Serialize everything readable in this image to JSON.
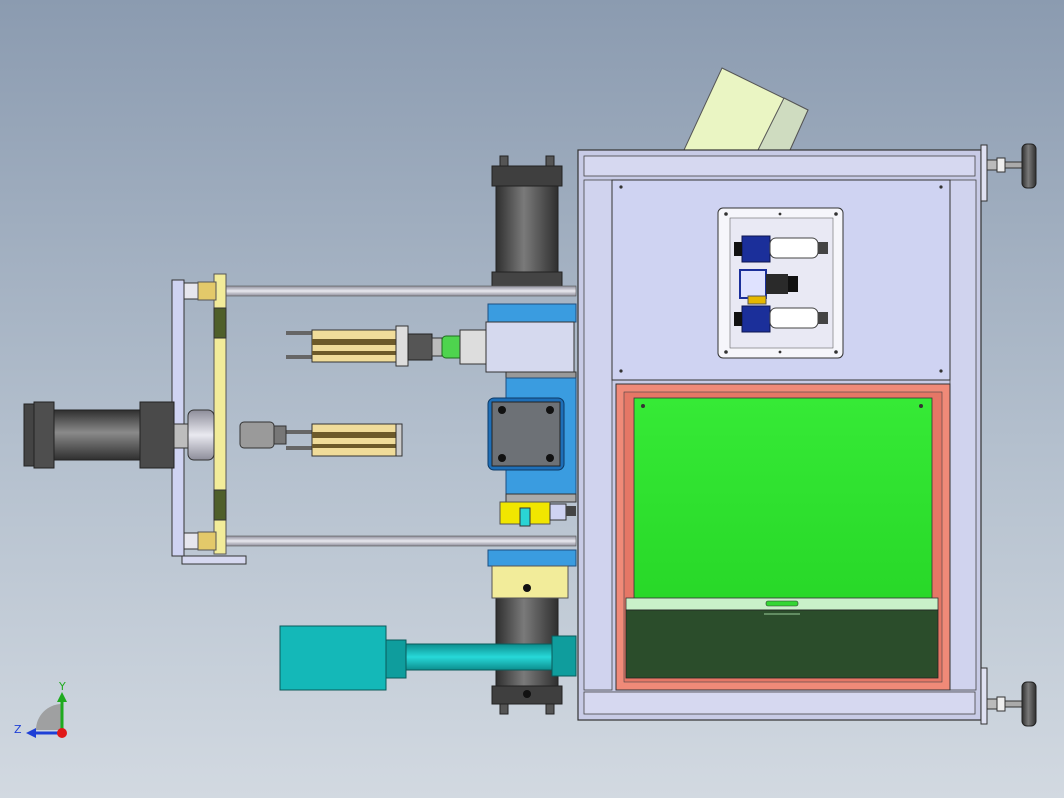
{
  "view": {
    "background_top": "#8b9bb0",
    "background_bottom": "#d2d9e1"
  },
  "triad": {
    "y_label": "Y",
    "z_label": "Z",
    "y_color": "#1faa1f",
    "z_color": "#1e3fd6",
    "x_color": "#e01818"
  },
  "colors": {
    "frame": "#c8cbe6",
    "panel": "#cfd3f2",
    "window_border": "#f08a78",
    "window_glass": "#33e433",
    "tray": "#2b4d2b",
    "blue_block": "#3a9ce0",
    "cylinder": "#5a5a5a",
    "teal_motor": "#14b8b8",
    "yellow_plate": "#f2ec9a",
    "pale_box": "#eaf5c3"
  }
}
